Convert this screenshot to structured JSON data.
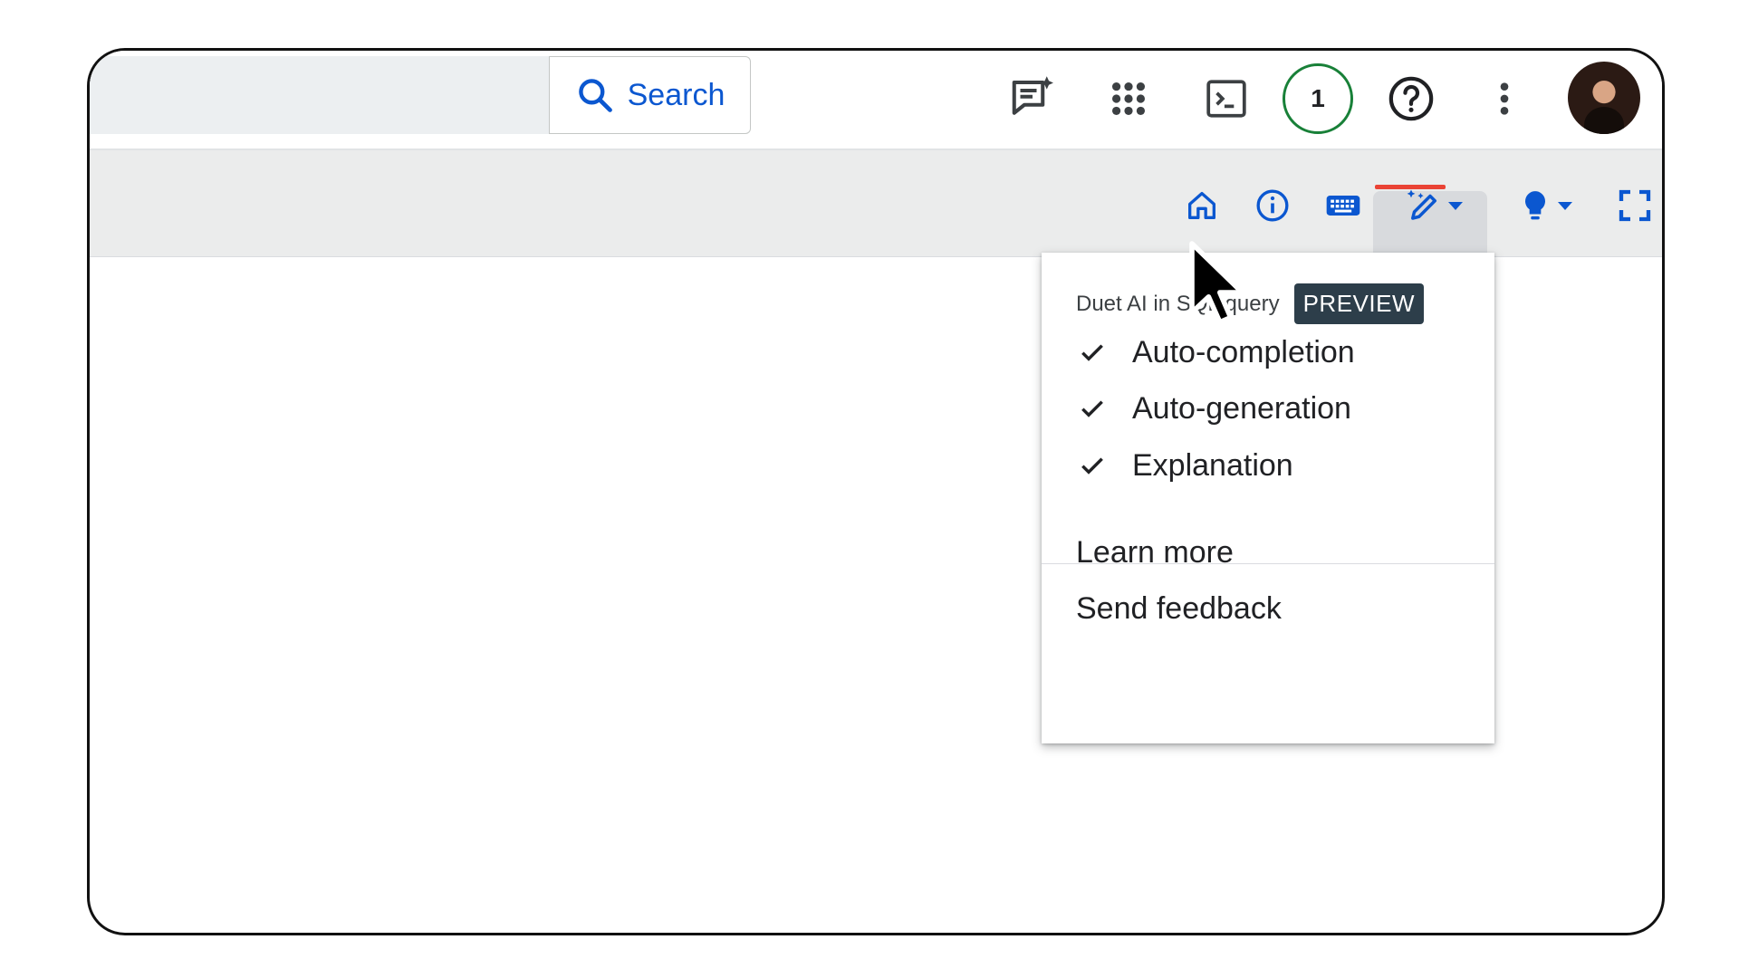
{
  "search": {
    "button_label": "Search",
    "field_value": ""
  },
  "topbar": {
    "notification_count": "1"
  },
  "menu": {
    "title": "Duet AI in SQL query",
    "badge": "PREVIEW",
    "items": [
      {
        "label": "Auto-completion",
        "checked": true
      },
      {
        "label": "Auto-generation",
        "checked": true
      },
      {
        "label": "Explanation",
        "checked": true
      }
    ],
    "links": [
      "Learn more",
      "Send feedback"
    ]
  },
  "icons": {
    "topbar": [
      "gemini-chat-icon",
      "apps-grid-icon",
      "cloud-shell-icon",
      "help-icon",
      "more-vert-icon"
    ],
    "toolbar": [
      "home-icon",
      "info-icon",
      "keyboard-icon",
      "duet-ai-pen-icon",
      "lightbulb-icon",
      "fullscreen-icon"
    ]
  },
  "colors": {
    "accent": "#0b57d0",
    "badge_ring": "#188038",
    "active_underline": "#ea4335",
    "preview_badge_bg": "#2d3e4a"
  }
}
